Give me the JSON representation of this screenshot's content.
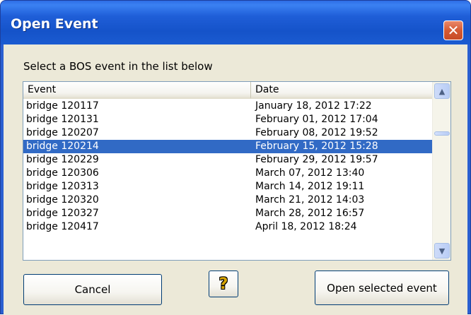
{
  "window": {
    "title": "Open Event",
    "close_icon": "close-icon",
    "close_glyph": "✕"
  },
  "instruction": "Select a BOS event in the list below",
  "list": {
    "columns": [
      "Event",
      "Date"
    ],
    "selected_index": 3,
    "rows": [
      {
        "event": "bridge 120117",
        "date": "January 18, 2012 17:22"
      },
      {
        "event": "bridge 120131",
        "date": "February 01, 2012 17:04"
      },
      {
        "event": "bridge 120207",
        "date": "February 08, 2012 19:52"
      },
      {
        "event": "bridge 120214",
        "date": "February 15, 2012 15:28"
      },
      {
        "event": "bridge 120229",
        "date": "February 29, 2012 19:57"
      },
      {
        "event": "bridge 120306",
        "date": "March 07, 2012 13:40"
      },
      {
        "event": "bridge 120313",
        "date": "March 14, 2012 19:11"
      },
      {
        "event": "bridge 120320",
        "date": "March 21, 2012 14:03"
      },
      {
        "event": "bridge 120327",
        "date": "March 28, 2012 16:57"
      },
      {
        "event": "bridge 120417",
        "date": "April 18, 2012 18:24"
      }
    ],
    "scroll_up_glyph": "▲",
    "scroll_down_glyph": "▼"
  },
  "buttons": {
    "cancel_label": "Cancel",
    "help_icon": "question-mark-icon",
    "help_glyph": "?",
    "open_label": "Open selected event"
  },
  "colors": {
    "selection": "#316ac5",
    "titlebar": "#1553c9",
    "dialog_face": "#ece9d8"
  }
}
